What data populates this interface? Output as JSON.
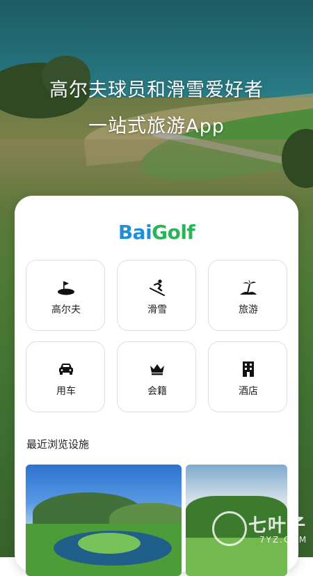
{
  "headline": {
    "line1": "高尔夫球员和滑雪爱好者",
    "line2": "一站式旅游App"
  },
  "logo": {
    "text_blue": "Bai",
    "text_green": "Golf"
  },
  "categories": [
    {
      "label": "高尔夫",
      "icon": "golf-icon"
    },
    {
      "label": "滑雪",
      "icon": "skiing-icon"
    },
    {
      "label": "旅游",
      "icon": "island-icon"
    },
    {
      "label": "用车",
      "icon": "car-icon"
    },
    {
      "label": "会籍",
      "icon": "crown-icon"
    },
    {
      "label": "酒店",
      "icon": "hotel-icon"
    }
  ],
  "recent": {
    "title": "最近浏览设施"
  },
  "watermark": {
    "text": "7YZ.COM"
  },
  "colors": {
    "logo_blue": "#1f8fd6",
    "logo_green": "#2bb35a",
    "tile_border": "#dedede"
  }
}
